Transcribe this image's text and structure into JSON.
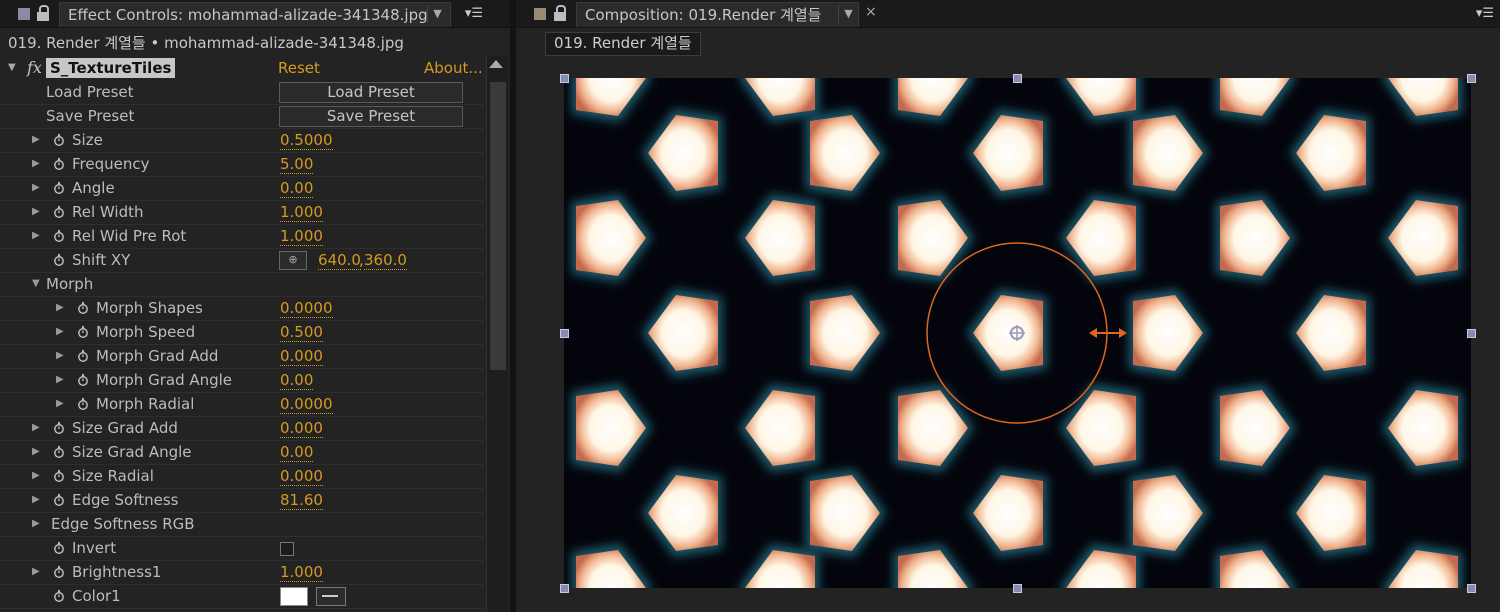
{
  "effect_tab": {
    "title": "Effect Controls: mohammad-alizade-341348.jpg",
    "color": "#8a8aa6"
  },
  "breadcrumb": "019. Render 계열들 • mohammad-alizade-341348.jpg",
  "effect": {
    "name": "S_TextureTiles",
    "reset_label": "Reset",
    "about_label": "About..."
  },
  "presets": {
    "load_label": "Load Preset",
    "load_button": "Load Preset",
    "save_label": "Save Preset",
    "save_button": "Save Preset"
  },
  "params": [
    {
      "label": "Size",
      "value": "0.5000"
    },
    {
      "label": "Frequency",
      "value": "5.00"
    },
    {
      "label": "Angle",
      "value": "0.00"
    },
    {
      "label": "Rel Width",
      "value": "1.000"
    },
    {
      "label": "Rel Wid Pre Rot",
      "value": "1.000"
    },
    {
      "label": "Shift XY",
      "x": "640.0",
      "y": "360.0"
    },
    {
      "label": "Morph"
    },
    {
      "label": "Morph Shapes",
      "value": "0.0000"
    },
    {
      "label": "Morph Speed",
      "value": "0.500"
    },
    {
      "label": "Morph Grad Add",
      "value": "0.000"
    },
    {
      "label": "Morph Grad Angle",
      "value": "0.00"
    },
    {
      "label": "Morph Radial",
      "value": "0.0000"
    },
    {
      "label": "Size Grad Add",
      "value": "0.000"
    },
    {
      "label": "Size Grad Angle",
      "value": "0.00"
    },
    {
      "label": "Size Radial",
      "value": "0.000"
    },
    {
      "label": "Edge Softness",
      "value": "81.60"
    },
    {
      "label": "Edge Softness RGB"
    },
    {
      "label": "Invert"
    },
    {
      "label": "Brightness1",
      "value": "1.000"
    },
    {
      "label": "Color1",
      "color": "#ffffff"
    }
  ],
  "comp_tab": {
    "title": "Composition: 019.Render 계열들",
    "color": "#9a8a72"
  },
  "comp_breadcrumb": "019. Render 계열들",
  "colors": {
    "accent_value": "#d59a1f",
    "gizmo": "#e0661e"
  }
}
